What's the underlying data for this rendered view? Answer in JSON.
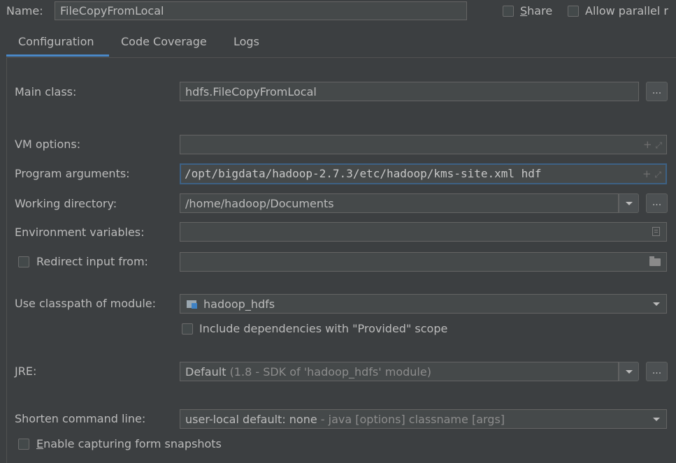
{
  "header": {
    "name_label": "Name:",
    "name_value": "FileCopyFromLocal",
    "share_label_pre": "",
    "share_label_u": "S",
    "share_label_post": "hare",
    "allow_parallel_label": "Allow parallel r"
  },
  "tabs": [
    {
      "label": "Configuration",
      "active": true
    },
    {
      "label": "Code Coverage",
      "active": false
    },
    {
      "label": "Logs",
      "active": false
    }
  ],
  "form": {
    "main_class_label": "Main class:",
    "main_class_value": "hdfs.FileCopyFromLocal",
    "vm_options_label": "VM options:",
    "vm_options_value": "",
    "program_args_label": "Program arguments:",
    "program_args_value": "/opt/bigdata/hadoop-2.7.3/etc/hadoop/kms-site.xml hdf",
    "working_dir_label": "Working directory:",
    "working_dir_value": "/home/hadoop/Documents",
    "env_vars_label": "Environment variables:",
    "env_vars_value": "",
    "redirect_label": "Redirect input from:",
    "redirect_value": "",
    "classpath_label": "Use classpath of module:",
    "classpath_value": "hadoop_hdfs",
    "include_deps_label": "Include dependencies with \"Provided\" scope",
    "jre_label": "JRE:",
    "jre_value_main": "Default",
    "jre_value_detail": "(1.8 - SDK of 'hadoop_hdfs' module)",
    "shorten_label": "Shorten command line:",
    "shorten_value_main": "user-local default: none",
    "shorten_value_detail": "- java [options] classname [args]",
    "capture_label_u": "E",
    "capture_label_post": "nable capturing form snapshots",
    "dots_label": "..."
  },
  "colors": {
    "background": "#3c3f41",
    "field_bg": "#45494a",
    "focus_border": "#3d6185",
    "tab_underline": "#4a88c7",
    "text": "#bbbbbb"
  }
}
